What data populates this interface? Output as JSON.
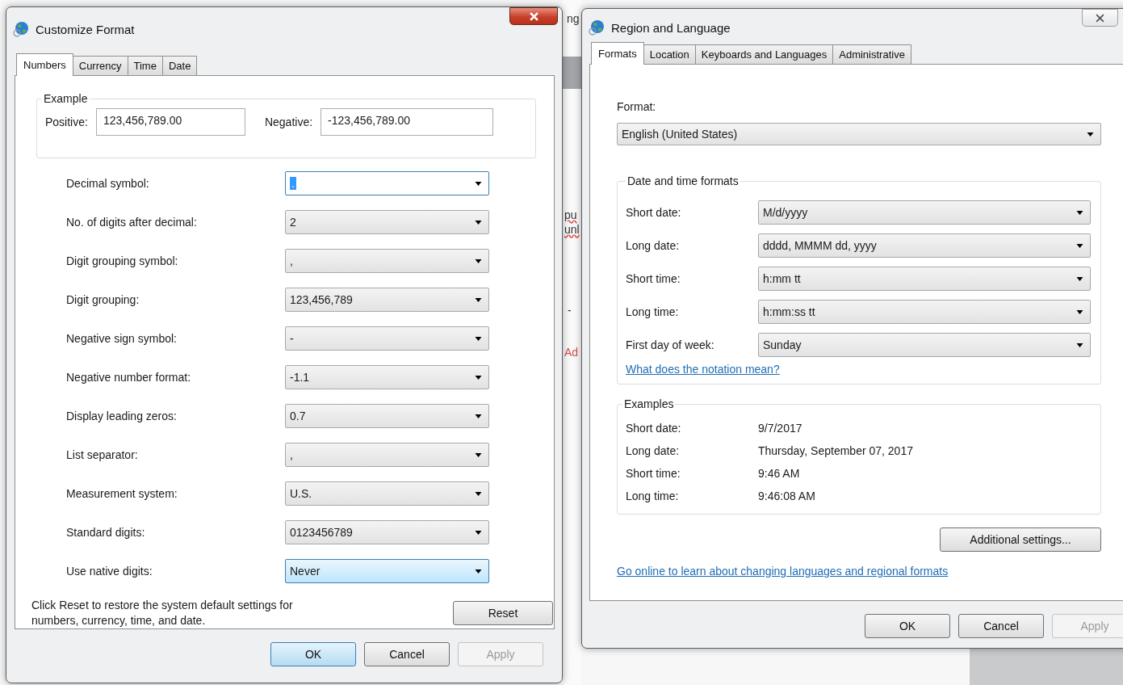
{
  "background": {
    "fragments": [
      {
        "text": "ng",
        "kind": "plain"
      },
      {
        "text": "pu",
        "kind": "misspelled"
      },
      {
        "text": "unl",
        "kind": "misspelled"
      },
      {
        "text": "-",
        "kind": "plain"
      },
      {
        "text": "Ad",
        "kind": "red"
      }
    ]
  },
  "customize_format": {
    "title": "Customize Format",
    "tabs": [
      {
        "label": "Numbers",
        "selected": true
      },
      {
        "label": "Currency",
        "selected": false
      },
      {
        "label": "Time",
        "selected": false
      },
      {
        "label": "Date",
        "selected": false
      }
    ],
    "example": {
      "label": "Example",
      "positive_label": "Positive:",
      "positive": "123,456,789.00",
      "negative_label": "Negative:",
      "negative": "-123,456,789.00"
    },
    "settings": [
      {
        "label": "Decimal symbol:",
        "value": ".",
        "focused": true,
        "hovered": false
      },
      {
        "label": "No. of digits after decimal:",
        "value": "2",
        "focused": false,
        "hovered": false
      },
      {
        "label": "Digit grouping symbol:",
        "value": ",",
        "focused": false,
        "hovered": false
      },
      {
        "label": "Digit grouping:",
        "value": "123,456,789",
        "focused": false,
        "hovered": false
      },
      {
        "label": "Negative sign symbol:",
        "value": "-",
        "focused": false,
        "hovered": false
      },
      {
        "label": "Negative number format:",
        "value": "-1.1",
        "focused": false,
        "hovered": false
      },
      {
        "label": "Display leading zeros:",
        "value": "0.7",
        "focused": false,
        "hovered": false
      },
      {
        "label": "List separator:",
        "value": ",",
        "focused": false,
        "hovered": false
      },
      {
        "label": "Measurement system:",
        "value": "U.S.",
        "focused": false,
        "hovered": false
      },
      {
        "label": "Standard digits:",
        "value": "0123456789",
        "focused": false,
        "hovered": false
      },
      {
        "label": "Use native digits:",
        "value": "Never",
        "focused": false,
        "hovered": true
      }
    ],
    "reset_note": "Click Reset to restore the system default settings for numbers, currency, time, and date.",
    "reset_button": "Reset",
    "buttons": [
      {
        "label": "OK",
        "default": true,
        "disabled": false
      },
      {
        "label": "Cancel",
        "default": false,
        "disabled": false
      },
      {
        "label": "Apply",
        "default": false,
        "disabled": true
      }
    ]
  },
  "region_and_language": {
    "title": "Region and Language",
    "tabs": [
      {
        "label": "Formats",
        "selected": true
      },
      {
        "label": "Location",
        "selected": false
      },
      {
        "label": "Keyboards and Languages",
        "selected": false
      },
      {
        "label": "Administrative",
        "selected": false
      }
    ],
    "format_label": "Format:",
    "format": "English (United States)",
    "date_time": {
      "label": "Date and time formats",
      "rows": [
        {
          "label": "Short date:",
          "value": "M/d/yyyy"
        },
        {
          "label": "Long date:",
          "value": "dddd, MMMM dd, yyyy"
        },
        {
          "label": "Short time:",
          "value": "h:mm tt"
        },
        {
          "label": "Long time:",
          "value": "h:mm:ss tt"
        },
        {
          "label": "First day of week:",
          "value": "Sunday"
        }
      ],
      "link": "What does the notation mean?"
    },
    "examples": {
      "label": "Examples",
      "rows": [
        {
          "label": "Short date:",
          "value": "9/7/2017"
        },
        {
          "label": "Long date:",
          "value": "Thursday, September 07, 2017"
        },
        {
          "label": "Short time:",
          "value": "9:46 AM"
        },
        {
          "label": "Long time:",
          "value": "9:46:08 AM"
        }
      ]
    },
    "additional_button": "Additional settings...",
    "online_link": "Go online to learn about changing languages and regional formats",
    "buttons": [
      {
        "label": "OK",
        "default": false,
        "disabled": false
      },
      {
        "label": "Cancel",
        "default": false,
        "disabled": false
      },
      {
        "label": "Apply",
        "default": false,
        "disabled": true
      }
    ]
  }
}
